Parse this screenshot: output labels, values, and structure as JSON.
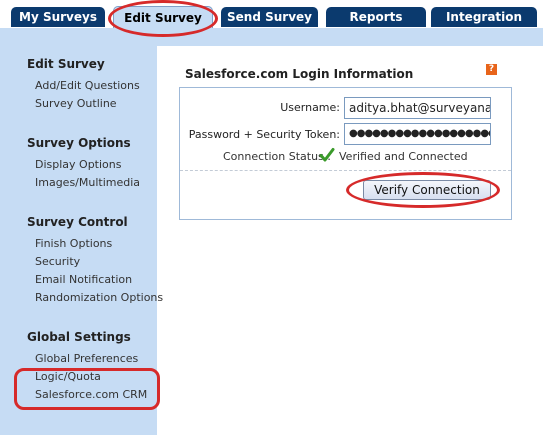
{
  "tabs": [
    {
      "label": "My Surveys",
      "active": false
    },
    {
      "label": "Edit Survey",
      "active": true
    },
    {
      "label": "Send Survey",
      "active": false
    },
    {
      "label": "Reports",
      "active": false
    },
    {
      "label": "Integration",
      "active": false
    }
  ],
  "sidebar": {
    "sections": [
      {
        "heading": "Edit Survey",
        "items": [
          "Add/Edit Questions",
          "Survey Outline"
        ]
      },
      {
        "heading": "Survey Options",
        "items": [
          "Display Options",
          "Images/Multimedia"
        ]
      },
      {
        "heading": "Survey Control",
        "items": [
          "Finish Options",
          "Security",
          "Email Notification",
          "Randomization Options"
        ]
      },
      {
        "heading": "Global Settings",
        "items": [
          "Global Preferences",
          "Logic/Quota",
          "Salesforce.com CRM"
        ]
      }
    ]
  },
  "login": {
    "title": "Salesforce.com Login Information",
    "help_icon": "?",
    "username_label": "Username:",
    "username_value": "aditya.bhat@surveyanalytics.com",
    "password_label": "Password + Security Token:",
    "password_value": "●●●●●●●●●●●●●●●●●●●●●●●●●●●●",
    "status_label": "Connection Status :",
    "status_value": "Verified and Connected",
    "verify_button": "Verify Connection"
  },
  "colors": {
    "tab_bg": "#0b3a6e",
    "tab_active_bg": "#c6dcf4",
    "sidebar_bg": "#c6dcf4",
    "highlight": "#d62a2a",
    "check": "#3a9a2a"
  },
  "icons": {
    "help": "help-icon",
    "status": "checkmark-icon"
  }
}
